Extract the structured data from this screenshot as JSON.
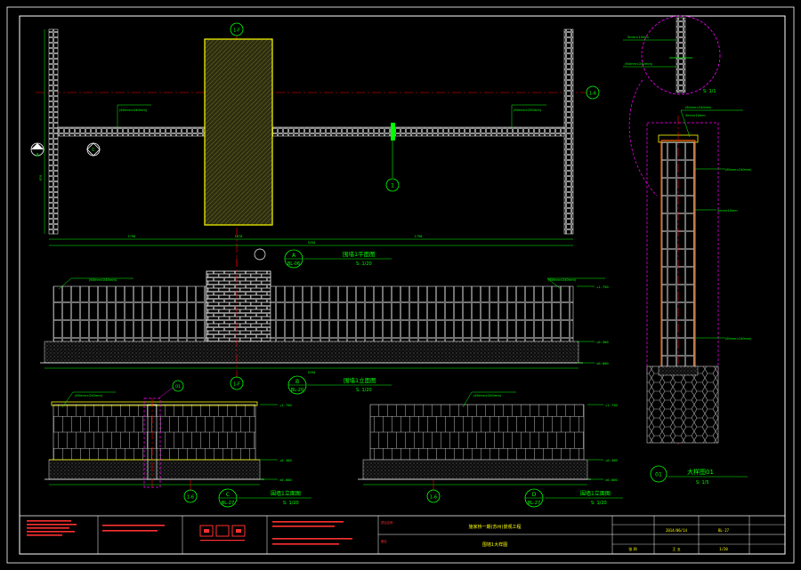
{
  "views": {
    "plan": {
      "axis_top": "1-F",
      "axis_right": "1-6",
      "dims_bottom": [
        "1790",
        "1670",
        "1790"
      ],
      "dim_total": "5250",
      "dim_left": "970",
      "callout_left": "A",
      "callout_right": "C",
      "callout_mid": "1",
      "note_left": "(60mm×240mm)",
      "note_right": "(60mm×240mm)",
      "ref_letter": "A",
      "ref_sheet": "BL-06",
      "title": "围墙1平面图",
      "scale": "S: 1/20"
    },
    "elev_a": {
      "axis_bottom": "1-F",
      "note_left": "(60mm×240mm)",
      "note_right": "(60mm×240mm)",
      "levels": [
        "+1.750",
        "+0.300",
        "±0.000"
      ],
      "dim_total": "5250",
      "ref_letter": "B",
      "ref_sheet": "BL-20",
      "title": "围墙1立面图",
      "scale": "S: 1/20"
    },
    "elev_c": {
      "axis_bottom": "1-6",
      "note": "(60mm×240mm)",
      "callout": "01",
      "levels": [
        "+1.750",
        "+0.300",
        "±0.000"
      ],
      "ref_letter": "C",
      "ref_sheet": "BL-27",
      "title": "围墙1立面图",
      "scale": "S: 1/20"
    },
    "elev_d": {
      "axis_bottom": "1-6",
      "note": "(60mm×240mm)",
      "levels": [
        "+1.750",
        "+0.300",
        "±0.000"
      ],
      "ref_letter": "D",
      "ref_sheet": "BL-27",
      "title": "围墙1立面图",
      "scale": "S: 1/20"
    },
    "detail": {
      "zoom_label": "S: 1/1",
      "zoom_note1": "5mm×10mm",
      "zoom_note2": "(60mm×240mm)",
      "notes": [
        "(60mm×240mm)",
        "5mm×10mm",
        "(60mm×240mm)",
        "5mm×10mm",
        "(60mm×240mm)"
      ],
      "ref_number": "01",
      "title": "大样图01",
      "scale": "S: 1/5"
    }
  },
  "title_block": {
    "project_name": "施家桥一期(苏州)景观工程",
    "drawing_name": "围墙1大样图",
    "date": "2014/06/14",
    "sheet_no": "BL-27",
    "scale": "1/20",
    "designer": "张 四",
    "checker": "王 五",
    "project_label": "项目名称",
    "drawing_label": "图名"
  },
  "colors": {
    "background": "#000000",
    "frame": "#ffffff",
    "brick": "#d8d8d8",
    "dim": "#00ff00",
    "text": "#00ff00",
    "yellow": "#ffff00",
    "axis": "#ff0000",
    "hatch_dark": "#4a4a1a",
    "magenta": "#ff00ff",
    "orange": "#ff6600"
  }
}
